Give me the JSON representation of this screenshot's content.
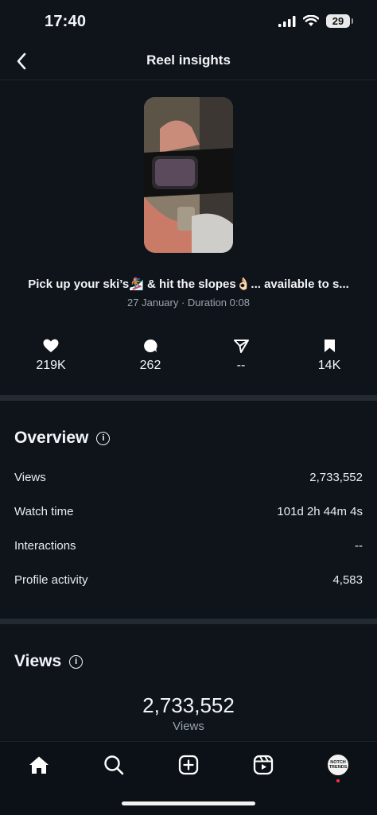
{
  "status_bar": {
    "time": "17:40",
    "battery": "29"
  },
  "nav": {
    "title": "Reel insights"
  },
  "reel": {
    "caption": "Pick up your ski’s🏂 & hit the slopes👌🏻... available to s...",
    "meta": "27 January · Duration 0:08"
  },
  "stats": {
    "likes": "219K",
    "comments": "262",
    "shares": "--",
    "saves": "14K"
  },
  "overview": {
    "title": "Overview",
    "rows": [
      {
        "label": "Views",
        "value": "2,733,552"
      },
      {
        "label": "Watch time",
        "value": "101d 2h 44m 4s"
      },
      {
        "label": "Interactions",
        "value": "--"
      },
      {
        "label": "Profile activity",
        "value": "4,583"
      }
    ]
  },
  "views_section": {
    "title": "Views",
    "total": "2,733,552",
    "label": "Views"
  },
  "avatar": {
    "text": "NOTCH TRENDS"
  }
}
